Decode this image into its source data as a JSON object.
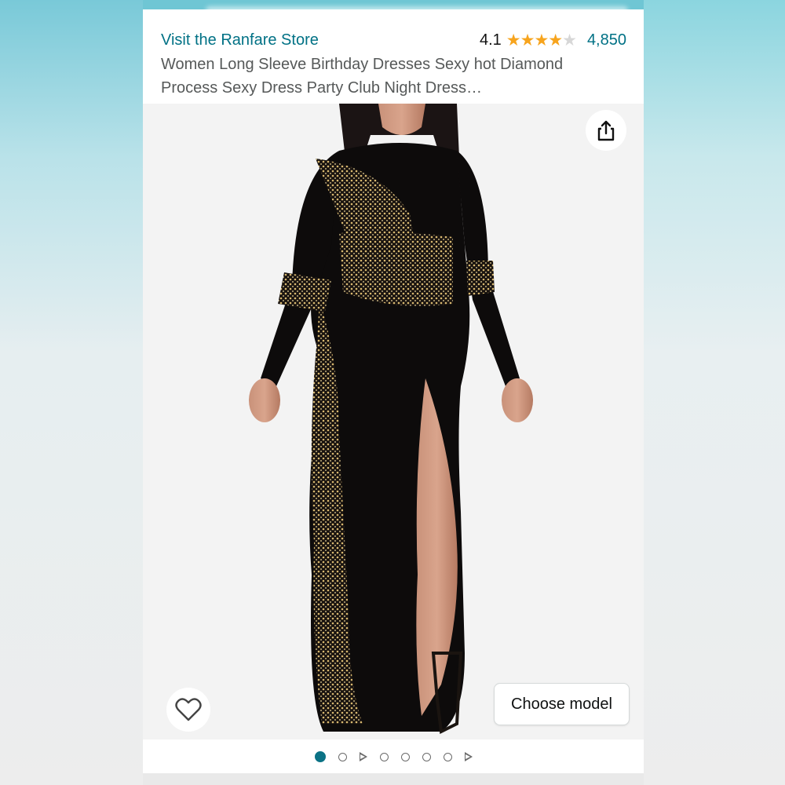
{
  "store": {
    "link_text": "Visit the Ranfare Store"
  },
  "rating": {
    "value": "4.1",
    "stars": 4.1,
    "max_stars": 5,
    "count": "4,850"
  },
  "product": {
    "title": "Women Long Sleeve Birthday Dresses Sexy hot Diamond Process Sexy Dress Party Club Night Dress…"
  },
  "image": {
    "description_icon": "product-photo",
    "current_index": 1,
    "total": 8
  },
  "buttons": {
    "choose_model": "Choose model",
    "share_icon": "share-icon",
    "wishlist_icon": "heart-icon"
  },
  "carousel": {
    "items": [
      "dot",
      "dot",
      "video",
      "dot",
      "dot",
      "dot",
      "dot",
      "video"
    ]
  },
  "colors": {
    "link": "#007185",
    "star": "#f7a41d",
    "active_dot": "#0b7285"
  }
}
